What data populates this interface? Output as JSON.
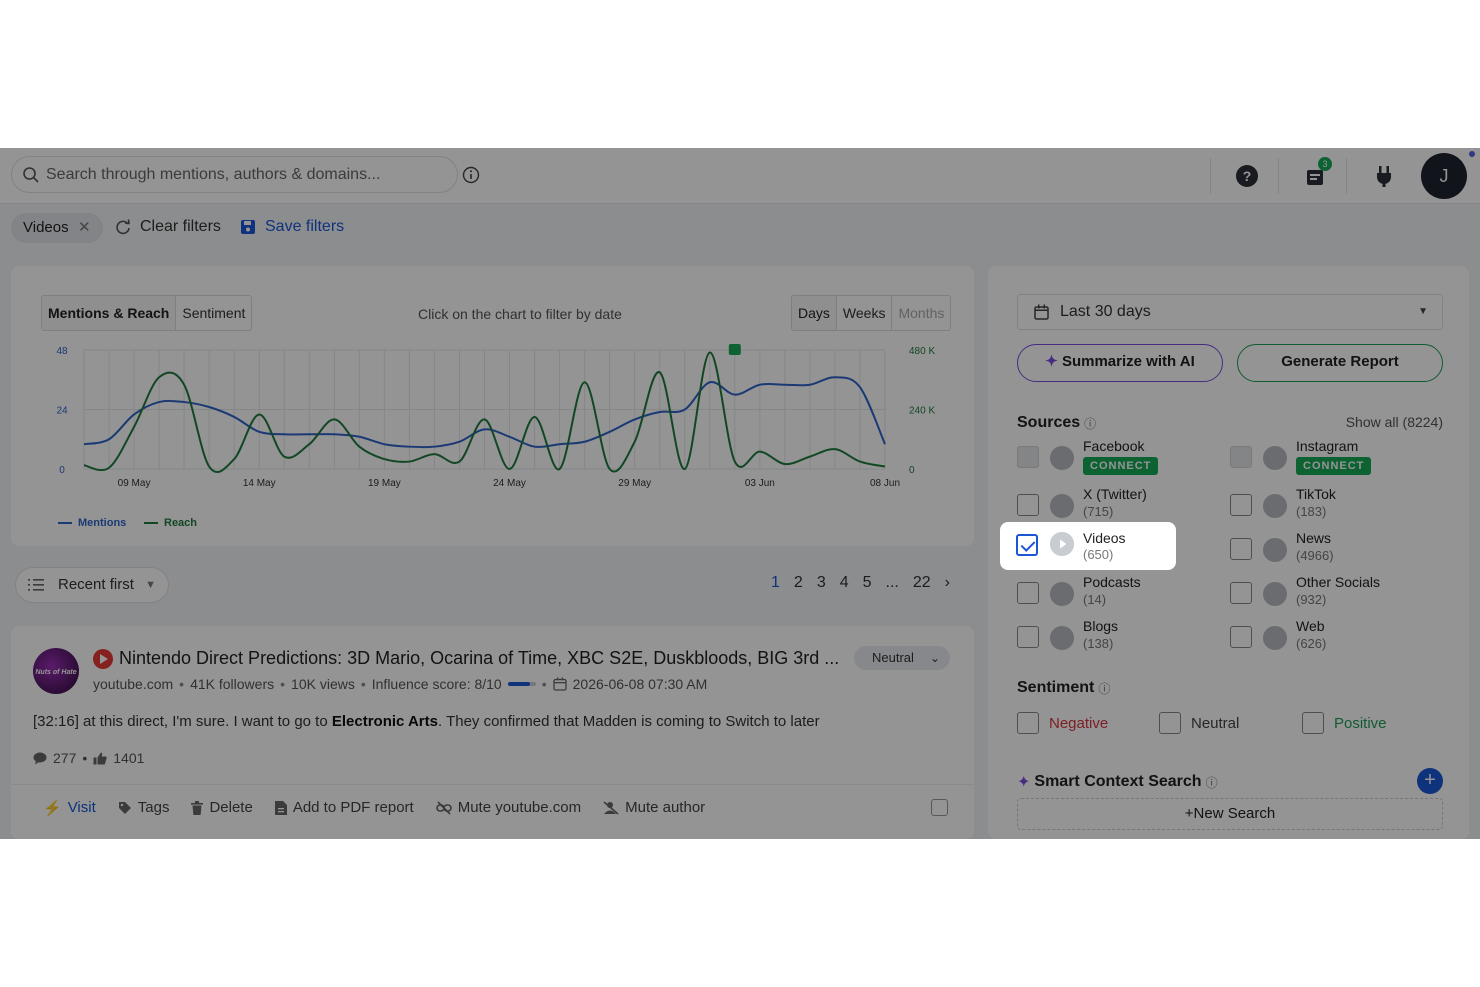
{
  "topbar": {
    "search_placeholder": "Search through mentions, authors & domains...",
    "notification_count": "3",
    "avatar_initial": "J"
  },
  "filters": {
    "active_chip": "Videos",
    "clear_label": "Clear filters",
    "save_label": "Save filters"
  },
  "chart_panel": {
    "tabs": [
      "Mentions & Reach",
      "Sentiment"
    ],
    "hint": "Click on the chart to filter by date",
    "granularity": [
      "Days",
      "Weeks",
      "Months"
    ],
    "legend": {
      "mentions": "Mentions",
      "reach": "Reach"
    }
  },
  "chart_data": {
    "type": "line",
    "x": [
      "07 May",
      "08 May",
      "09 May",
      "10 May",
      "11 May",
      "12 May",
      "13 May",
      "14 May",
      "15 May",
      "16 May",
      "17 May",
      "18 May",
      "19 May",
      "20 May",
      "21 May",
      "22 May",
      "23 May",
      "24 May",
      "25 May",
      "26 May",
      "27 May",
      "28 May",
      "29 May",
      "30 May",
      "31 May",
      "01 Jun",
      "02 Jun",
      "03 Jun",
      "04 Jun",
      "05 Jun",
      "06 Jun",
      "07 Jun",
      "08 Jun"
    ],
    "x_tick_labels": [
      "09 May",
      "14 May",
      "19 May",
      "24 May",
      "29 May",
      "03 Jun",
      "08 Jun"
    ],
    "series": [
      {
        "name": "Mentions",
        "axis": "left",
        "color": "#2f63c8",
        "values": [
          10,
          12,
          22,
          27,
          27,
          25,
          21,
          15,
          14,
          14,
          14,
          13,
          10,
          9,
          9,
          11,
          16,
          13,
          9,
          10,
          11,
          15,
          20,
          23,
          24,
          35,
          30,
          34,
          34,
          34,
          37,
          33,
          10
        ]
      },
      {
        "name": "Reach",
        "axis": "right",
        "color": "#1f7a3f",
        "values": [
          15000,
          5000,
          170000,
          370000,
          340000,
          10000,
          40000,
          220000,
          50000,
          100000,
          200000,
          90000,
          40000,
          30000,
          60000,
          30000,
          200000,
          0,
          210000,
          0,
          350000,
          0,
          110000,
          390000,
          0,
          470000,
          30000,
          70000,
          20000,
          50000,
          80000,
          30000,
          10000
        ]
      }
    ],
    "y_left": {
      "ticks": [
        "0",
        "24",
        "48"
      ],
      "range": [
        0,
        48
      ]
    },
    "y_right": {
      "ticks": [
        "0",
        "240 K",
        "480 K"
      ],
      "range": [
        0,
        480000
      ]
    },
    "annotation_marker_date": "02 Jun",
    "grid": true,
    "legend_position": "bottom-left"
  },
  "sort": {
    "label": "Recent first"
  },
  "pagination": {
    "pages": [
      "1",
      "2",
      "3",
      "4",
      "5",
      "...",
      "22"
    ],
    "current": "1"
  },
  "mention": {
    "avatar_text": "Nuts of Hate",
    "title": "Nintendo Direct Predictions: 3D Mario, Ocarina of Time, XBC S2E, Duskbloods, BIG 3rd ...",
    "source": "youtube.com",
    "followers": "41K followers",
    "views": "10K views",
    "influence": "Influence score: 8/10",
    "influence_fraction": 0.8,
    "date": "2026-06-08 07:30 AM",
    "sentiment": "Neutral",
    "body_before": "[32:16] at this direct, I'm sure. I want to go to ",
    "body_bold": "Electronic Arts",
    "body_after": ". They confirmed that Madden is coming to Switch to later",
    "comments": "277",
    "likes": "1401",
    "actions": {
      "visit": "Visit",
      "tags": "Tags",
      "delete": "Delete",
      "pdf": "Add to PDF report",
      "mute_domain": "Mute youtube.com",
      "mute_author": "Mute author"
    }
  },
  "right": {
    "date_range": "Last 30 days",
    "summarize": "Summarize with AI",
    "report": "Generate Report",
    "sources_title": "Sources",
    "show_all": "Show all (8224)",
    "sources": [
      {
        "name": "Facebook",
        "count": "",
        "connect": "CONNECT",
        "icon": "facebook-icon"
      },
      {
        "name": "Instagram",
        "count": "",
        "connect": "CONNECT",
        "icon": "instagram-icon"
      },
      {
        "name": "X (Twitter)",
        "count": "(715)",
        "connect": "",
        "icon": "x-icon"
      },
      {
        "name": "TikTok",
        "count": "(183)",
        "connect": "",
        "icon": "tiktok-icon"
      },
      {
        "name": "Videos",
        "count": "(650)",
        "connect": "",
        "icon": "play-icon"
      },
      {
        "name": "News",
        "count": "(4966)",
        "connect": "",
        "icon": "news-icon"
      },
      {
        "name": "Podcasts",
        "count": "(14)",
        "connect": "",
        "icon": "podcast-icon"
      },
      {
        "name": "Other Socials",
        "count": "(932)",
        "connect": "",
        "icon": "chat-icon"
      },
      {
        "name": "Blogs",
        "count": "(138)",
        "connect": "",
        "icon": "rss-icon"
      },
      {
        "name": "Web",
        "count": "(626)",
        "connect": "",
        "icon": "share-icon"
      }
    ],
    "sentiment_title": "Sentiment",
    "sentiments": {
      "negative": "Negative",
      "neutral": "Neutral",
      "positive": "Positive"
    },
    "smart_title": "Smart Context Search",
    "new_search": "New Search",
    "colors": {
      "negative": "#d9363e",
      "positive": "#1f9d55",
      "accent": "#1a56d6",
      "ai": "#7b4fe0"
    }
  }
}
